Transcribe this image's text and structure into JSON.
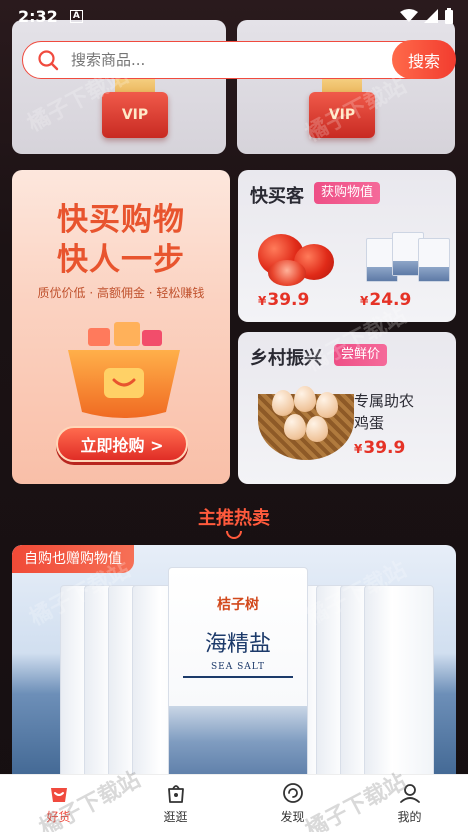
{
  "status_bar": {
    "time": "2:32",
    "notification": "A"
  },
  "search": {
    "placeholder": "搜索商品...",
    "button_label": "搜索"
  },
  "vip_cards": {
    "left_badge": "VIP",
    "right_badge": "VIP"
  },
  "promo": {
    "title_line1": "快买购物",
    "title_line2": "快人一步",
    "subtitle": "质优价低 · 高额佣金 · 轻松赚钱",
    "button_label": "立即抢购 >"
  },
  "fast_card": {
    "title": "快买客",
    "tag": "获购物值",
    "items": [
      {
        "name": "tomato",
        "currency": "¥",
        "price": "39.9"
      },
      {
        "name": "sea-salt",
        "currency": "¥",
        "price": "24.9"
      }
    ]
  },
  "rural_card": {
    "title": "乡村振兴",
    "tag": "尝鲜价",
    "desc_line1": "专属助农",
    "desc_line2": "鸡蛋",
    "currency": "¥",
    "price": "39.9"
  },
  "section": {
    "title": "主推热卖"
  },
  "banner": {
    "tag": "自购也赠购物值",
    "brand": "桔子树",
    "product_name": "海精盐",
    "product_en": "SEA SALT"
  },
  "nav": {
    "items": [
      {
        "label": "好货",
        "active": true
      },
      {
        "label": "逛逛",
        "active": false
      },
      {
        "label": "发现",
        "active": false
      },
      {
        "label": "我的",
        "active": false
      }
    ]
  },
  "watermark": "橘子下载站",
  "colors": {
    "accent": "#f04a3e",
    "tag_pink": "#ee4f86",
    "price_red": "#e53226"
  }
}
